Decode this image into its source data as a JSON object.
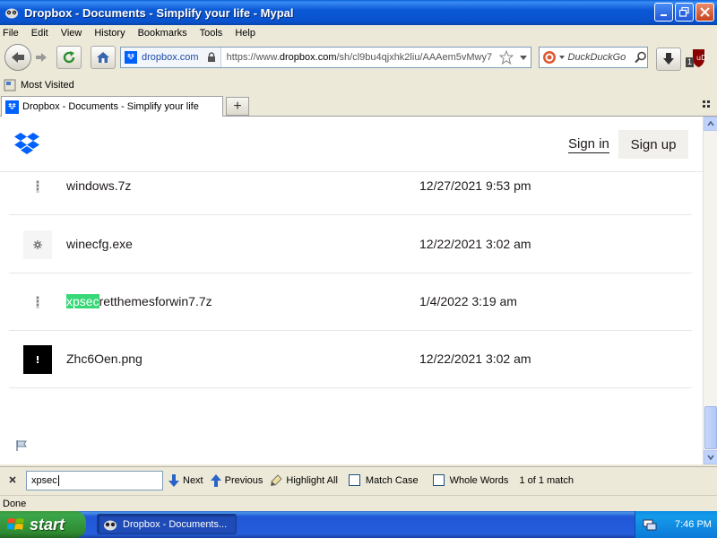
{
  "window": {
    "title": "Dropbox - Documents - Simplify your life - Mypal"
  },
  "menu": [
    "File",
    "Edit",
    "View",
    "History",
    "Bookmarks",
    "Tools",
    "Help"
  ],
  "navbar": {
    "site_identity": "dropbox.com",
    "url_prefix": "https://www.",
    "url_domain": "dropbox.com",
    "url_path": "/sh/cl9bu4qjxhk2liu/AAAem5vMwy7",
    "search_engine": "DuckDuckGo",
    "ublock_count": "1"
  },
  "bookmarks": {
    "most_visited": "Most Visited"
  },
  "tabs": [
    {
      "label": "Dropbox - Documents - Simplify your life"
    }
  ],
  "page": {
    "sign_in": "Sign in",
    "sign_up": "Sign up",
    "files": [
      {
        "name_pre": "",
        "name_match": "",
        "name_post": "windows.7z",
        "date": "12/27/2021 9:53 pm",
        "icon": "archive-icon"
      },
      {
        "name_pre": "",
        "name_match": "",
        "name_post": "winecfg.exe",
        "date": "12/22/2021 3:02 am",
        "icon": "exe-gear-icon"
      },
      {
        "name_pre": "",
        "name_match": "xpsec",
        "name_post": "retthemesforwin7.7z",
        "date": "1/4/2022 3:19 am",
        "icon": "archive-icon"
      },
      {
        "name_pre": "",
        "name_match": "",
        "name_post": "Zhc6Oen.png",
        "date": "12/22/2021 3:02 am",
        "icon": "image-thumbnail"
      }
    ]
  },
  "findbar": {
    "query": "xpsec",
    "next": "Next",
    "previous": "Previous",
    "highlight_all": "Highlight All",
    "match_case": "Match Case",
    "whole_words": "Whole Words",
    "match_count": "1 of 1 match"
  },
  "status": {
    "text": "Done"
  },
  "taskbar": {
    "start": "start",
    "task_label": "Dropbox - Documents...",
    "clock": "7:46 PM"
  },
  "colors": {
    "dropbox_blue": "#0061fe",
    "find_highlight": "#38d878"
  }
}
